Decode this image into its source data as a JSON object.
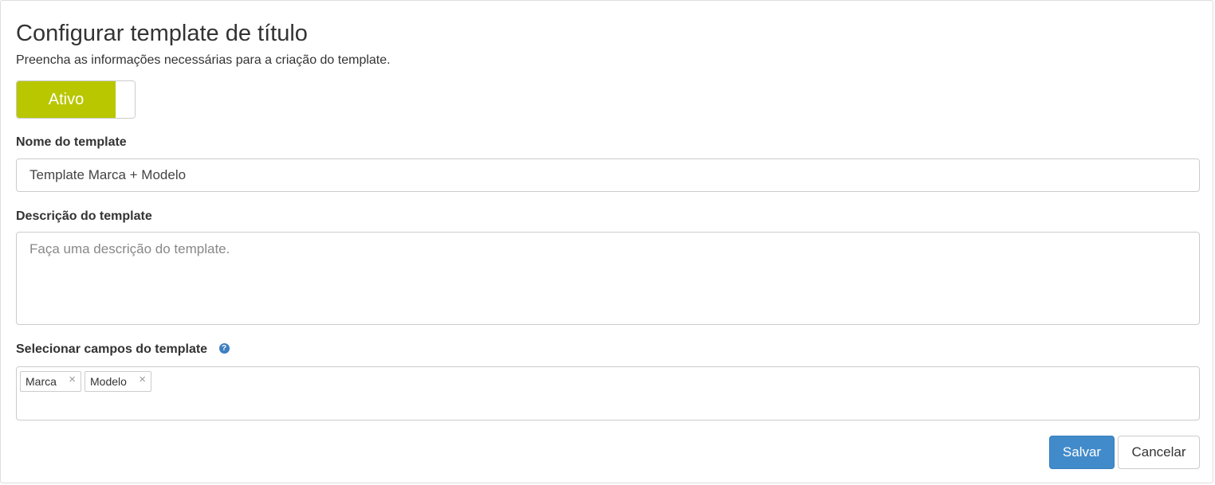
{
  "header": {
    "title": "Configurar template de título",
    "subtitle": "Preencha as informações necessárias para a criação do template."
  },
  "status_toggle": {
    "label": "Ativo",
    "state": "on",
    "on_color": "#b8c700"
  },
  "form": {
    "name": {
      "label": "Nome do template",
      "value": "Template Marca + Modelo"
    },
    "description": {
      "label": "Descrição do template",
      "value": "",
      "placeholder": "Faça uma descrição do template."
    },
    "fields": {
      "label": "Selecionar campos do template",
      "help_icon": "question-circle-icon",
      "help_glyph": "?",
      "selected": [
        {
          "label": "Marca",
          "remove_glyph": "×"
        },
        {
          "label": "Modelo",
          "remove_glyph": "×"
        }
      ]
    }
  },
  "actions": {
    "save_label": "Salvar",
    "cancel_label": "Cancelar",
    "primary_color": "#428bca"
  }
}
